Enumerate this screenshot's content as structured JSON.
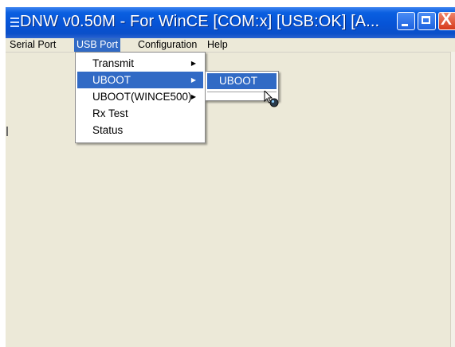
{
  "window": {
    "title": "DNW v0.50M - For WinCE    [COM:x] [USB:OK] [A...",
    "controls": {
      "minimize": "minimize",
      "maximize": "maximize",
      "close": "X"
    }
  },
  "menubar": {
    "items": [
      {
        "label": "Serial Port"
      },
      {
        "label": "USB Port"
      },
      {
        "label": "Configuration"
      },
      {
        "label": "Help"
      }
    ],
    "active": "USB Port"
  },
  "usb_port_menu": {
    "items": [
      {
        "label": "Transmit",
        "has_submenu": true
      },
      {
        "label": "UBOOT",
        "has_submenu": true,
        "highlighted": true
      },
      {
        "label": "UBOOT(WINCE500)",
        "has_submenu": true
      },
      {
        "label": "Rx Test",
        "has_submenu": false
      },
      {
        "label": "Status",
        "has_submenu": false
      }
    ],
    "submenu_arrow": "▶"
  },
  "uboot_submenu": {
    "items": [
      {
        "label": "UBOOT",
        "highlighted": true
      }
    ]
  },
  "colors": {
    "titlebar": "#0653d6",
    "highlight": "#316ac5",
    "window_bg": "#ece9d8",
    "close_button": "#d6391a"
  },
  "icons": {
    "app_icon": "menu-lines-icon",
    "cursor": "busy-cursor-icon"
  }
}
